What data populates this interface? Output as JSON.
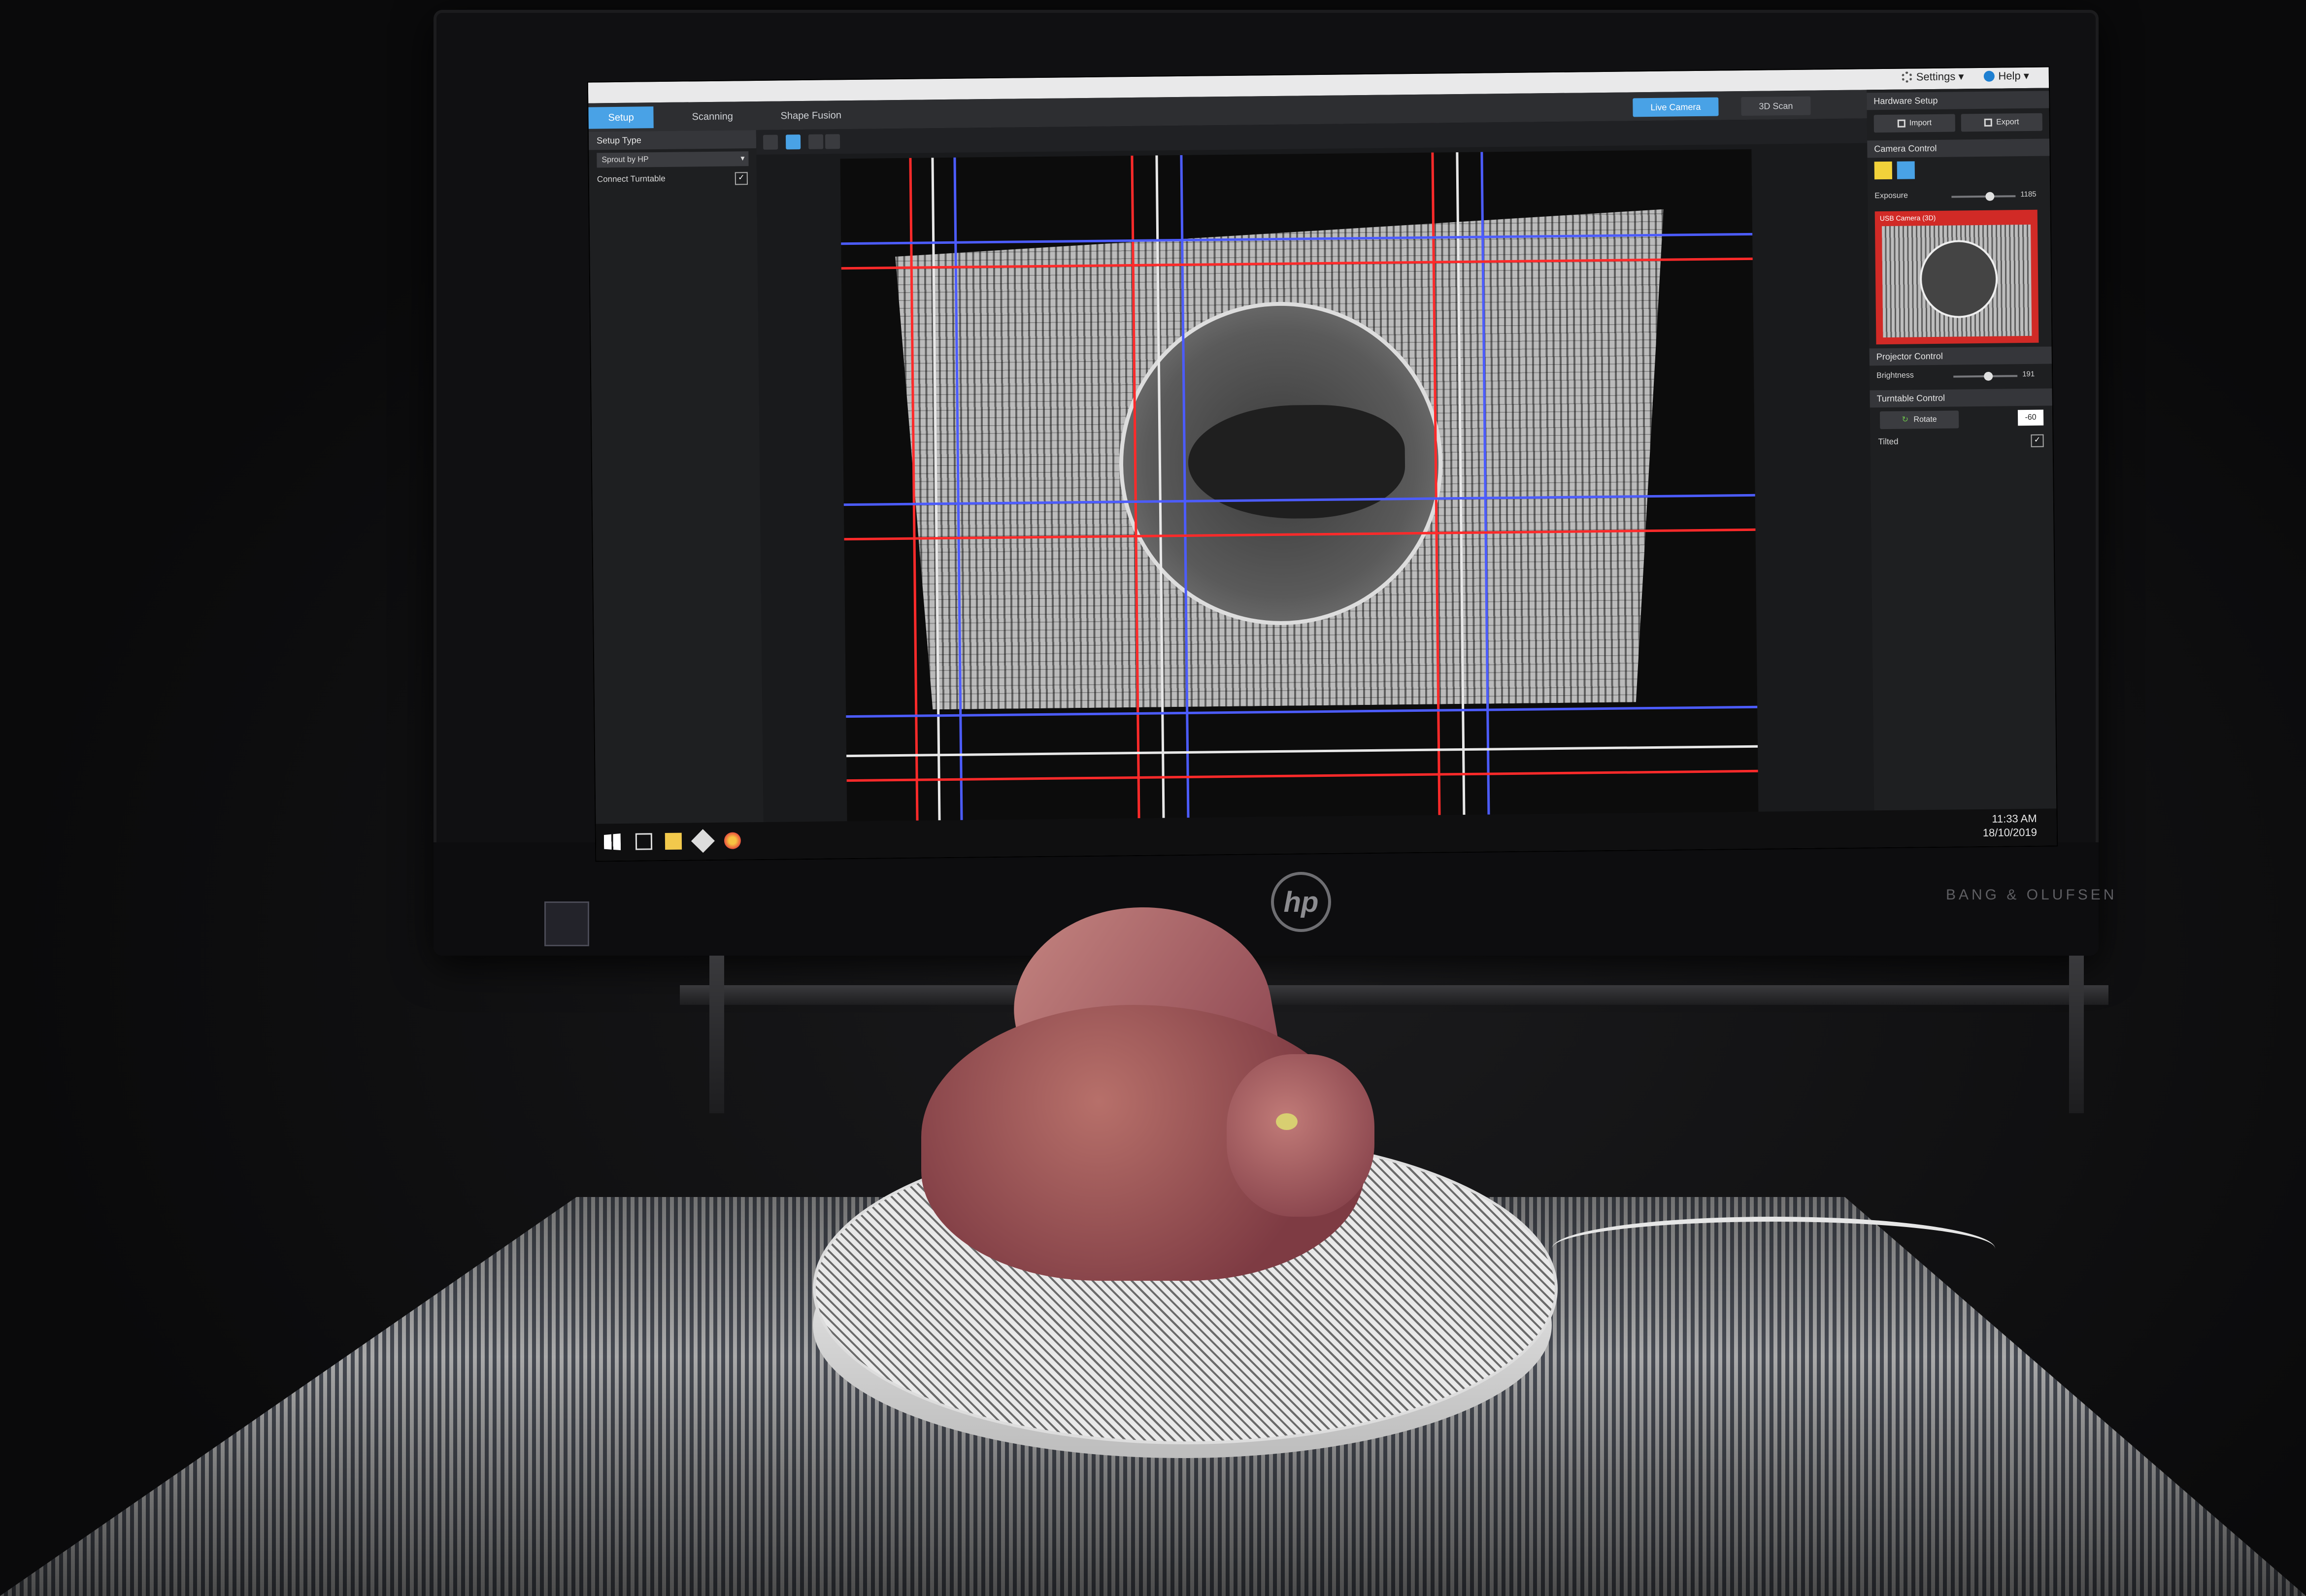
{
  "app": {
    "top_menu": {
      "settings": "Settings ▾",
      "help": "Help ▾"
    },
    "tabs": [
      "Setup",
      "Scanning",
      "Shape Fusion"
    ],
    "active_tab": "Setup",
    "view_buttons": {
      "live_camera": "Live Camera",
      "scan_3d": "3D Scan"
    }
  },
  "left_panel": {
    "setup_type_label": "Setup Type",
    "setup_type_value": "Sprout by HP",
    "connect_turntable_label": "Connect Turntable",
    "connect_turntable_checked": "✓"
  },
  "right_panel": {
    "hardware_setup": {
      "title": "Hardware Setup",
      "import": "Import",
      "export": "Export"
    },
    "camera_control": {
      "title": "Camera Control",
      "exposure_label": "Exposure",
      "exposure_value": "1185",
      "exposure_fraction": 0.62,
      "preview_label": "USB Camera (3D)"
    },
    "projector_control": {
      "title": "Projector Control",
      "brightness_label": "Brightness",
      "brightness_value": "191",
      "brightness_fraction": 0.55
    },
    "turntable_control": {
      "title": "Turntable Control",
      "rotate_label": "Rotate",
      "angle_value": "-60",
      "tilted_label": "Tilted",
      "tilted_checked": "✓"
    }
  },
  "taskbar": {
    "time": "11:33 AM",
    "date": "18/10/2019"
  },
  "hardware": {
    "monitor_brand": "hp",
    "speaker_brand": "BANG & OLUFSEN"
  },
  "colors": {
    "accent": "#49a2e6",
    "red_overlay": "#ff2a2a",
    "blue_overlay": "#4c5cff",
    "preview_border": "#d12a26"
  }
}
